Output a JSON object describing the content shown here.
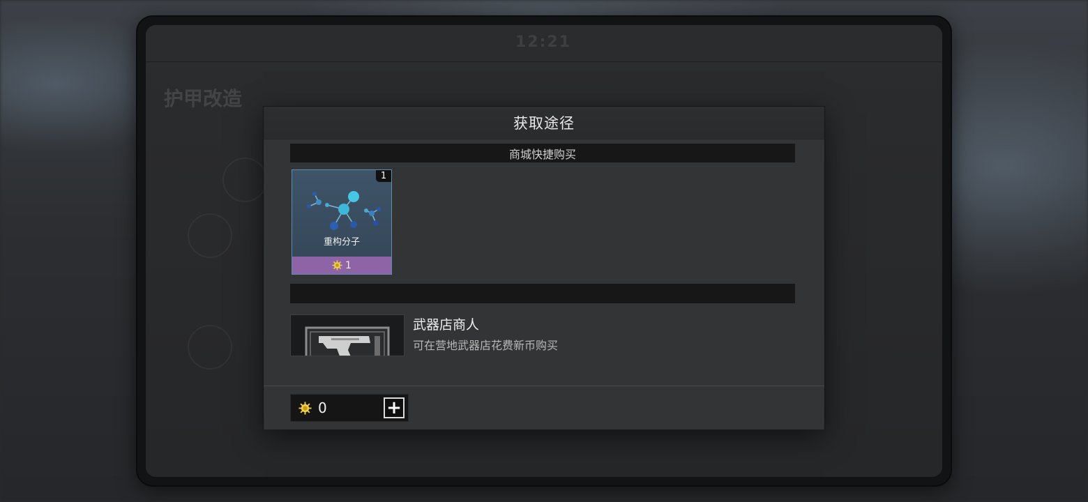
{
  "modal": {
    "title": "获取途径",
    "shop_section_label": "商城快捷购买",
    "item": {
      "name": "重构分子",
      "count": "1",
      "price": "1",
      "icon": "molecule-icon",
      "price_bar_color": "#8e64a6"
    },
    "source": {
      "name": "武器店商人",
      "description": "可在营地武器店花费新币购买",
      "icon": "pistol-icon"
    },
    "footer": {
      "currency_value": "0",
      "currency_icon": "gold-coin-icon",
      "add_icon": "plus-icon"
    }
  }
}
